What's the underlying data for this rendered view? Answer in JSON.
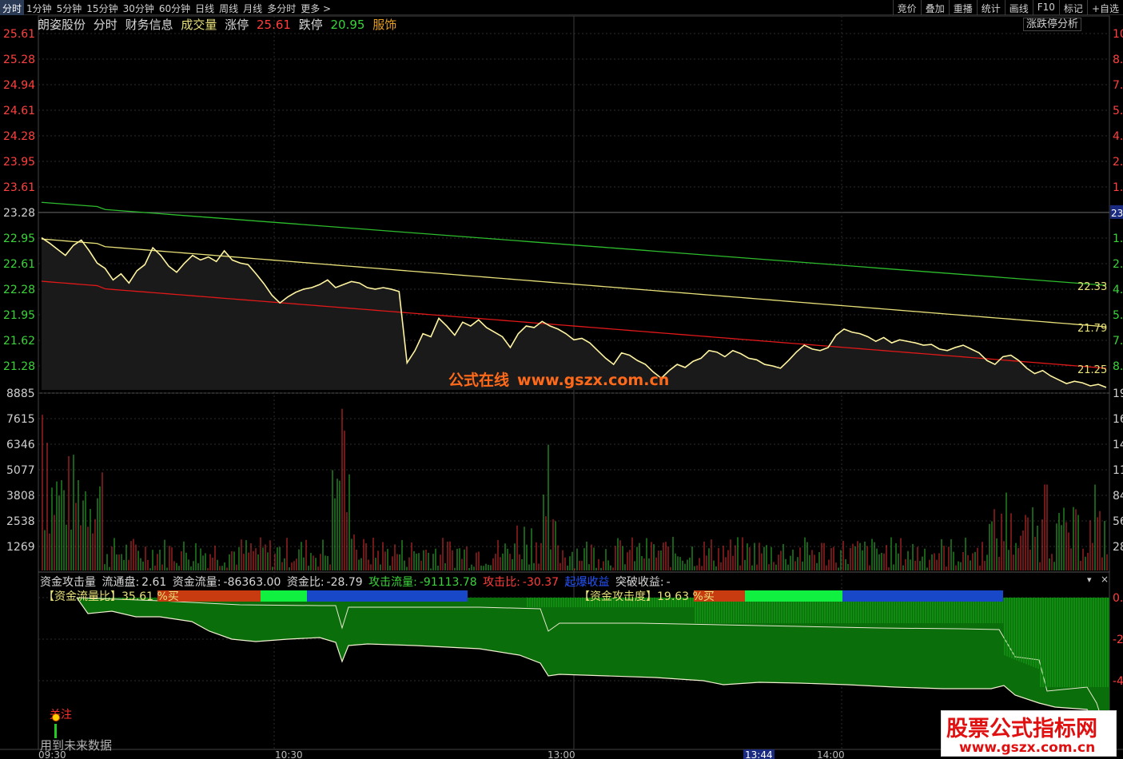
{
  "toolbar": {
    "periods": [
      "分时",
      "1分钟",
      "5分钟",
      "15分钟",
      "30分钟",
      "60分钟",
      "日线",
      "周线",
      "月线",
      "多分时",
      "更多 >"
    ],
    "active_period": "分时",
    "tools": [
      "竞价",
      "叠加",
      "重播",
      "统计",
      "画线",
      "F10",
      "标记",
      "+自选"
    ]
  },
  "info": {
    "stock_name": "朗姿股份",
    "tab_intraday": "分时",
    "tab_finance": "财务信息",
    "volume_label": "成交量",
    "limit_up_label": "涨停",
    "limit_up_value": "25.61",
    "limit_down_label": "跌停",
    "limit_down_value": "20.95",
    "industry": "服饰",
    "analysis_button": "涨跌停分析"
  },
  "price_axis": {
    "labels": [
      "25.61",
      "25.28",
      "24.94",
      "24.61",
      "24.28",
      "23.95",
      "23.61",
      "23.28",
      "22.95",
      "22.61",
      "22.28",
      "21.95",
      "21.62",
      "21.28"
    ],
    "right_labels": [
      "10",
      "8.",
      "7.",
      "5.",
      "4.",
      "2.",
      "1.",
      "",
      "1.",
      "2.",
      "4.",
      "5.",
      "7.",
      "8."
    ],
    "current_tag": "23",
    "line_end_labels": [
      "22.33",
      "21.79",
      "21.25"
    ]
  },
  "volume_axis": {
    "labels": [
      "8885",
      "7615",
      "6346",
      "5077",
      "3808",
      "2538",
      "1269"
    ],
    "right_labels": [
      "19",
      "16",
      "14",
      "11",
      "84",
      "56",
      "28"
    ]
  },
  "indicator": {
    "name": "资金攻击量",
    "float_label": "流通盘:",
    "float_value": "2.61",
    "flow_label": "资金流量:",
    "flow_value": "-86363.00",
    "ratio_label": "资金比:",
    "ratio_value": "-28.79",
    "attack_flow_label": "攻击流量:",
    "attack_flow_value": "-91113.78",
    "attack_ratio_label": "攻击比:",
    "attack_ratio_value": "-30.37",
    "start_gain_label": "起爆收益",
    "break_gain_label": "突破收益:",
    "break_gain_value": "-",
    "flow_ratio_text": "【资金流量比】35.61 %买",
    "attack_degree_text": "【资金攻击度】19.63 %买",
    "right_labels": [
      "0.",
      "-2",
      "-4"
    ]
  },
  "overlay": {
    "watermark_name": "公式在线",
    "watermark_url": "www.gszx.com.cn",
    "follow_label": "关注",
    "future_data_label": "用到未来数据",
    "brand_title": "股票公式指标网",
    "brand_url": "www.gszx.com.cn"
  },
  "time_axis": {
    "labels": [
      "09:30",
      "10:30",
      "13:00",
      "13:44",
      "14:00"
    ],
    "highlighted": "13:44"
  },
  "colors": {
    "price_line": "#fff4a0",
    "avg_line": "#e8e078",
    "red_line": "#e01818",
    "green_line": "#2cbc2c",
    "up_bar": "#e03030",
    "down_bar": "#30c030",
    "area_fill": "#0a6e0a",
    "grid": "#2c2c2c"
  },
  "chart_data": {
    "type": "line",
    "price_series": [
      22.95,
      22.88,
      22.8,
      22.72,
      22.85,
      22.92,
      22.78,
      22.62,
      22.55,
      22.4,
      22.48,
      22.36,
      22.52,
      22.6,
      22.82,
      22.72,
      22.58,
      22.5,
      22.62,
      22.72,
      22.66,
      22.7,
      22.64,
      22.78,
      22.66,
      22.62,
      22.6,
      22.48,
      22.35,
      22.2,
      22.1,
      22.18,
      22.24,
      22.28,
      22.3,
      22.34,
      22.4,
      22.3,
      22.34,
      22.38,
      22.36,
      22.3,
      22.28,
      22.3,
      22.28,
      22.25,
      21.32,
      21.48,
      21.7,
      21.66,
      21.9,
      21.8,
      21.68,
      21.85,
      21.8,
      21.88,
      21.78,
      21.72,
      21.66,
      21.52,
      21.7,
      21.8,
      21.78,
      21.86,
      21.8,
      21.76,
      21.7,
      21.62,
      21.64,
      21.58,
      21.48,
      21.38,
      21.3,
      21.45,
      21.42,
      21.35,
      21.3,
      21.2,
      21.12,
      21.22,
      21.3,
      21.26,
      21.34,
      21.38,
      21.48,
      21.46,
      21.4,
      21.48,
      21.44,
      21.38,
      21.36,
      21.3,
      21.28,
      21.25,
      21.35,
      21.46,
      21.55,
      21.5,
      21.48,
      21.52,
      21.68,
      21.76,
      21.72,
      21.7,
      21.66,
      21.6,
      21.65,
      21.58,
      21.62,
      21.6,
      21.58,
      21.55,
      21.56,
      21.5,
      21.48,
      21.52,
      21.55,
      21.5,
      21.45,
      21.35,
      21.3,
      21.4,
      21.42,
      21.35,
      21.25,
      21.18,
      21.22,
      21.15,
      21.1,
      21.05,
      21.08,
      21.06,
      21.02,
      21.04,
      21.0
    ],
    "avg_series_start": 22.9,
    "avg_series_end": 21.79,
    "upper_series_start": 23.38,
    "upper_series_end": 22.33,
    "lower_series_start": 22.35,
    "lower_series_end": 21.25,
    "volume_max": 8885
  }
}
